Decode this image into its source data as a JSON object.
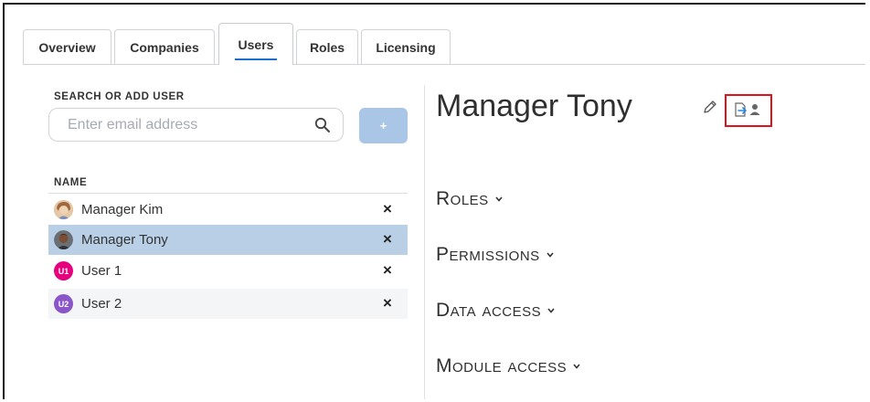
{
  "tabs": [
    {
      "label": "Overview"
    },
    {
      "label": "Companies"
    },
    {
      "label": "Users",
      "active": true
    },
    {
      "label": "Roles"
    },
    {
      "label": "Licensing"
    }
  ],
  "search": {
    "label": "SEARCH OR ADD USER",
    "placeholder": "Enter email address",
    "value": "",
    "add_button": "+"
  },
  "user_list": {
    "column_header": "NAME",
    "users": [
      {
        "name": "Manager Kim",
        "avatar": "photo",
        "selected": false
      },
      {
        "name": "Manager Tony",
        "avatar": "photo",
        "selected": true
      },
      {
        "name": "User 1",
        "avatar_initials": "U1",
        "avatar_color": "#e6007e",
        "selected": false
      },
      {
        "name": "User 2",
        "avatar_initials": "U2",
        "avatar_color": "#8a55c9",
        "selected": false
      }
    ],
    "remove_icon": "×"
  },
  "detail": {
    "title": "Manager Tony",
    "edit_icon": "pencil-icon",
    "export_icon": "export-user-icon",
    "sections": [
      "Roles",
      "Permissions",
      "Data access",
      "Module access"
    ]
  },
  "colors": {
    "accent": "#1b6fd1",
    "selected_row": "#b8cfe6",
    "add_button": "#a9c6e6",
    "highlight": "#e3111a"
  }
}
